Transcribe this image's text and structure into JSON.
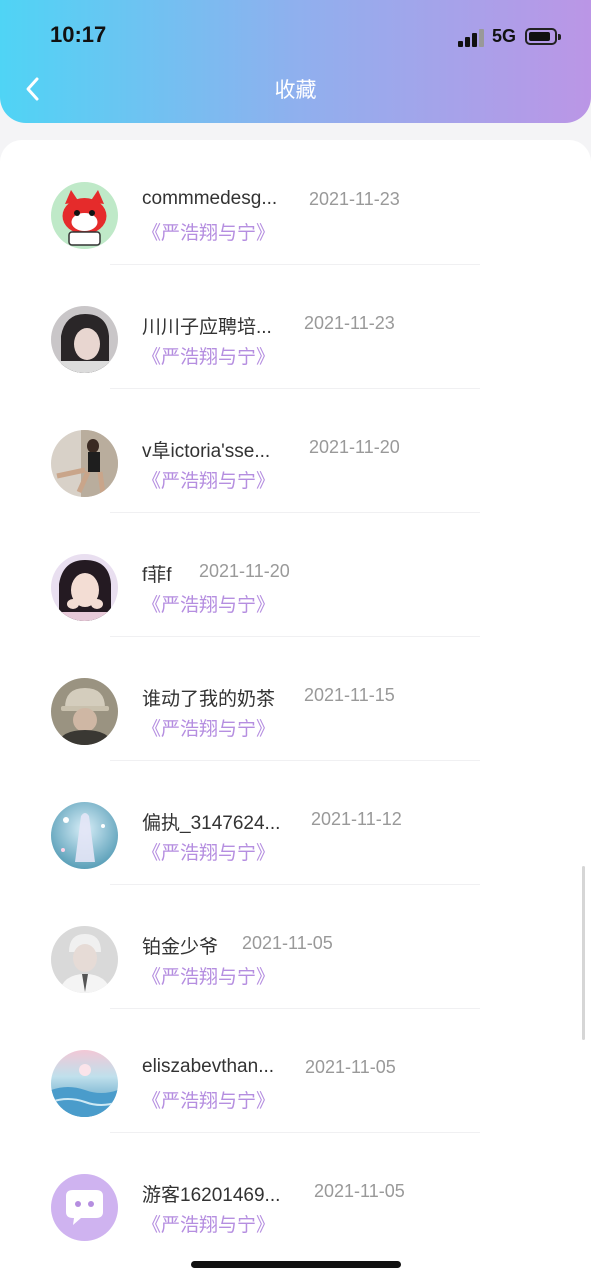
{
  "status_bar": {
    "time": "10:17",
    "network": "5G"
  },
  "header": {
    "title": "收藏"
  },
  "items": [
    {
      "name": "commmedesg...",
      "date": "2021-11-23",
      "book": "《严浩翔与宁》"
    },
    {
      "name": "川川子应聘培...",
      "date": "2021-11-23",
      "book": "《严浩翔与宁》"
    },
    {
      "name": "v阜ictoria'sse...",
      "date": "2021-11-20",
      "book": "《严浩翔与宁》"
    },
    {
      "name": "f菲f",
      "date": "2021-11-20",
      "book": "《严浩翔与宁》"
    },
    {
      "name": "谁动了我的奶茶",
      "date": "2021-11-15",
      "book": "《严浩翔与宁》"
    },
    {
      "name": "偏执_3147624...",
      "date": "2021-11-12",
      "book": "《严浩翔与宁》"
    },
    {
      "name": "铂金少爷",
      "date": "2021-11-05",
      "book": "《严浩翔与宁》"
    },
    {
      "name": "eliszabevthan...",
      "date": "2021-11-05",
      "book": "《严浩翔与宁》"
    },
    {
      "name": "游客16201469...",
      "date": "2021-11-05",
      "book": "《严浩翔与宁》"
    }
  ]
}
